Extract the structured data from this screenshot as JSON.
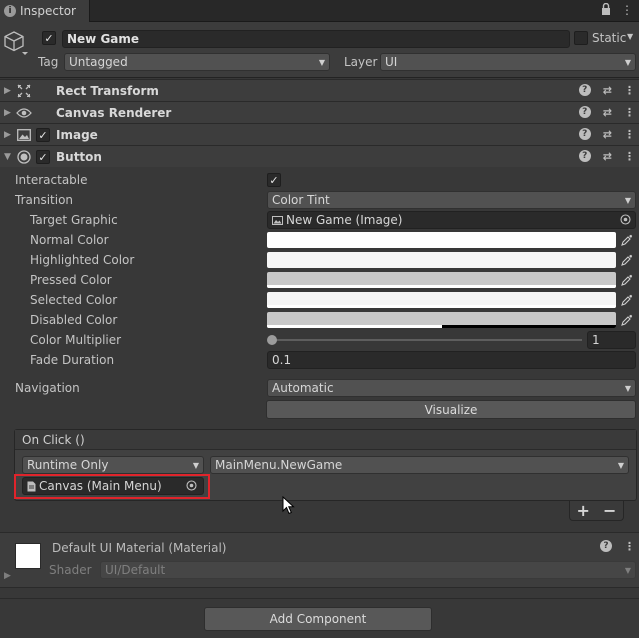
{
  "tab": {
    "label": "Inspector"
  },
  "gameobject": {
    "name": "New Game",
    "active": true,
    "static_label": "Static",
    "tag_label": "Tag",
    "tag_value": "Untagged",
    "layer_label": "Layer",
    "layer_value": "UI"
  },
  "components": [
    {
      "name": "Rect Transform",
      "icon": "rect-transform-icon"
    },
    {
      "name": "Canvas Renderer",
      "icon": "eye-icon"
    },
    {
      "name": "Image",
      "icon": "image-icon",
      "enabled": true
    },
    {
      "name": "Button",
      "icon": "button-icon",
      "enabled": true,
      "expanded": true
    }
  ],
  "button": {
    "interactable_label": "Interactable",
    "interactable": true,
    "transition_label": "Transition",
    "transition_value": "Color Tint",
    "target_graphic_label": "Target Graphic",
    "target_graphic_value": "New Game (Image)",
    "normal_color_label": "Normal Color",
    "highlighted_color_label": "Highlighted Color",
    "pressed_color_label": "Pressed Color",
    "selected_color_label": "Selected Color",
    "disabled_color_label": "Disabled Color",
    "colors": {
      "normal": "#FFFFFF",
      "highlighted": "#F5F5F5",
      "pressed": "#C8C8C8",
      "selected": "#F5F5F5",
      "disabled": "#C8C8C8"
    },
    "disabled_alpha": 0.5,
    "color_multiplier_label": "Color Multiplier",
    "color_multiplier_value": "1",
    "color_multiplier_fraction": 0,
    "fade_duration_label": "Fade Duration",
    "fade_duration_value": "0.1",
    "navigation_label": "Navigation",
    "navigation_value": "Automatic",
    "visualize_label": "Visualize"
  },
  "onclick": {
    "title": "On Click ()",
    "runtime_value": "Runtime Only",
    "function_value": "MainMenu.NewGame",
    "object_value": "Canvas (Main Menu)",
    "add_label": "+",
    "remove_label": "−"
  },
  "material": {
    "name": "Default UI Material (Material)",
    "shader_label": "Shader",
    "shader_value": "UI/Default"
  },
  "add_component_label": "Add Component",
  "colors": {
    "panel": "#383838",
    "highlight_border": "#E0242B"
  }
}
